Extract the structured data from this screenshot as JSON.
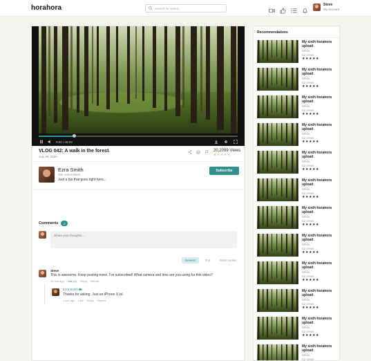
{
  "nav": {
    "logo": "horahora",
    "search_placeholder": "Search for videos",
    "icons": [
      "video-camera-icon",
      "thumbs-up-icon",
      "list-icon",
      "bell-icon"
    ],
    "user_name": "Steve",
    "user_sub": "My account"
  },
  "player": {
    "time": "0:20 / 45:03",
    "progress": 0.18
  },
  "video": {
    "title": "VLOG 042: A walk in the forest",
    "date": "July 28, 2020",
    "views": "20,2099 Views",
    "rating": 1,
    "rating_max": 5
  },
  "channel": {
    "name": "Ezra Smith",
    "subscribers": "30K subscribers",
    "description": "Just a bio that goes right here...",
    "subscribe_label": "Subscribe"
  },
  "comments": {
    "label": "Comments",
    "count": "2",
    "input_placeholder": "Share your thoughts...",
    "sort": [
      "Newest",
      "Top",
      "Most replies"
    ],
    "sort_active": 0,
    "items": [
      {
        "author": "Steve",
        "text": "This is awesome. Keep posting more. I've subscribed! What camera and lens are you using for this video?",
        "time": "10 min ago",
        "like": "Like (1)",
        "reply": "Reply",
        "report": "Report"
      }
    ],
    "reply": {
      "author": "Ezra Smith",
      "text": "Thanks for asking. Just an iPhone X lol.",
      "time": "1 sec ago",
      "like": "Like",
      "reply": "Reply",
      "report": "Report"
    }
  },
  "sidebar": {
    "title": "Recommendations",
    "items": [
      {
        "title": "My sixth horahora upload",
        "channel": "Steve",
        "views": "52 views",
        "rating": 1
      },
      {
        "title": "My sixth horahora upload",
        "channel": "Steve",
        "views": "52 views",
        "rating": 1
      },
      {
        "title": "My sixth horahora upload",
        "channel": "Steve",
        "views": "52 views",
        "rating": 1
      },
      {
        "title": "My sixth horahora upload",
        "channel": "Steve",
        "views": "52 views",
        "rating": 1
      },
      {
        "title": "My sixth horahora upload",
        "channel": "Steve",
        "views": "52 views",
        "rating": 1
      },
      {
        "title": "My sixth horahora upload",
        "channel": "Steve",
        "views": "52 views",
        "rating": 1
      },
      {
        "title": "My sixth horahora upload",
        "channel": "Steve",
        "views": "52 views",
        "rating": 1
      },
      {
        "title": "My sixth horahora upload",
        "channel": "Steve",
        "views": "52 views",
        "rating": 1
      },
      {
        "title": "My sixth horahora upload",
        "channel": "Steve",
        "views": "52 views",
        "rating": 1
      },
      {
        "title": "My sixth horahora upload",
        "channel": "Steve",
        "views": "52 views",
        "rating": 1
      },
      {
        "title": "My sixth horahora upload",
        "channel": "Steve",
        "views": "52 views",
        "rating": 1
      },
      {
        "title": "My sixth horahora upload",
        "channel": "Steve",
        "views": "52 views",
        "rating": 1
      }
    ]
  },
  "colors": {
    "accent": "#2f8f8a",
    "star": "#e4b820",
    "background": "#f6f4ee"
  }
}
